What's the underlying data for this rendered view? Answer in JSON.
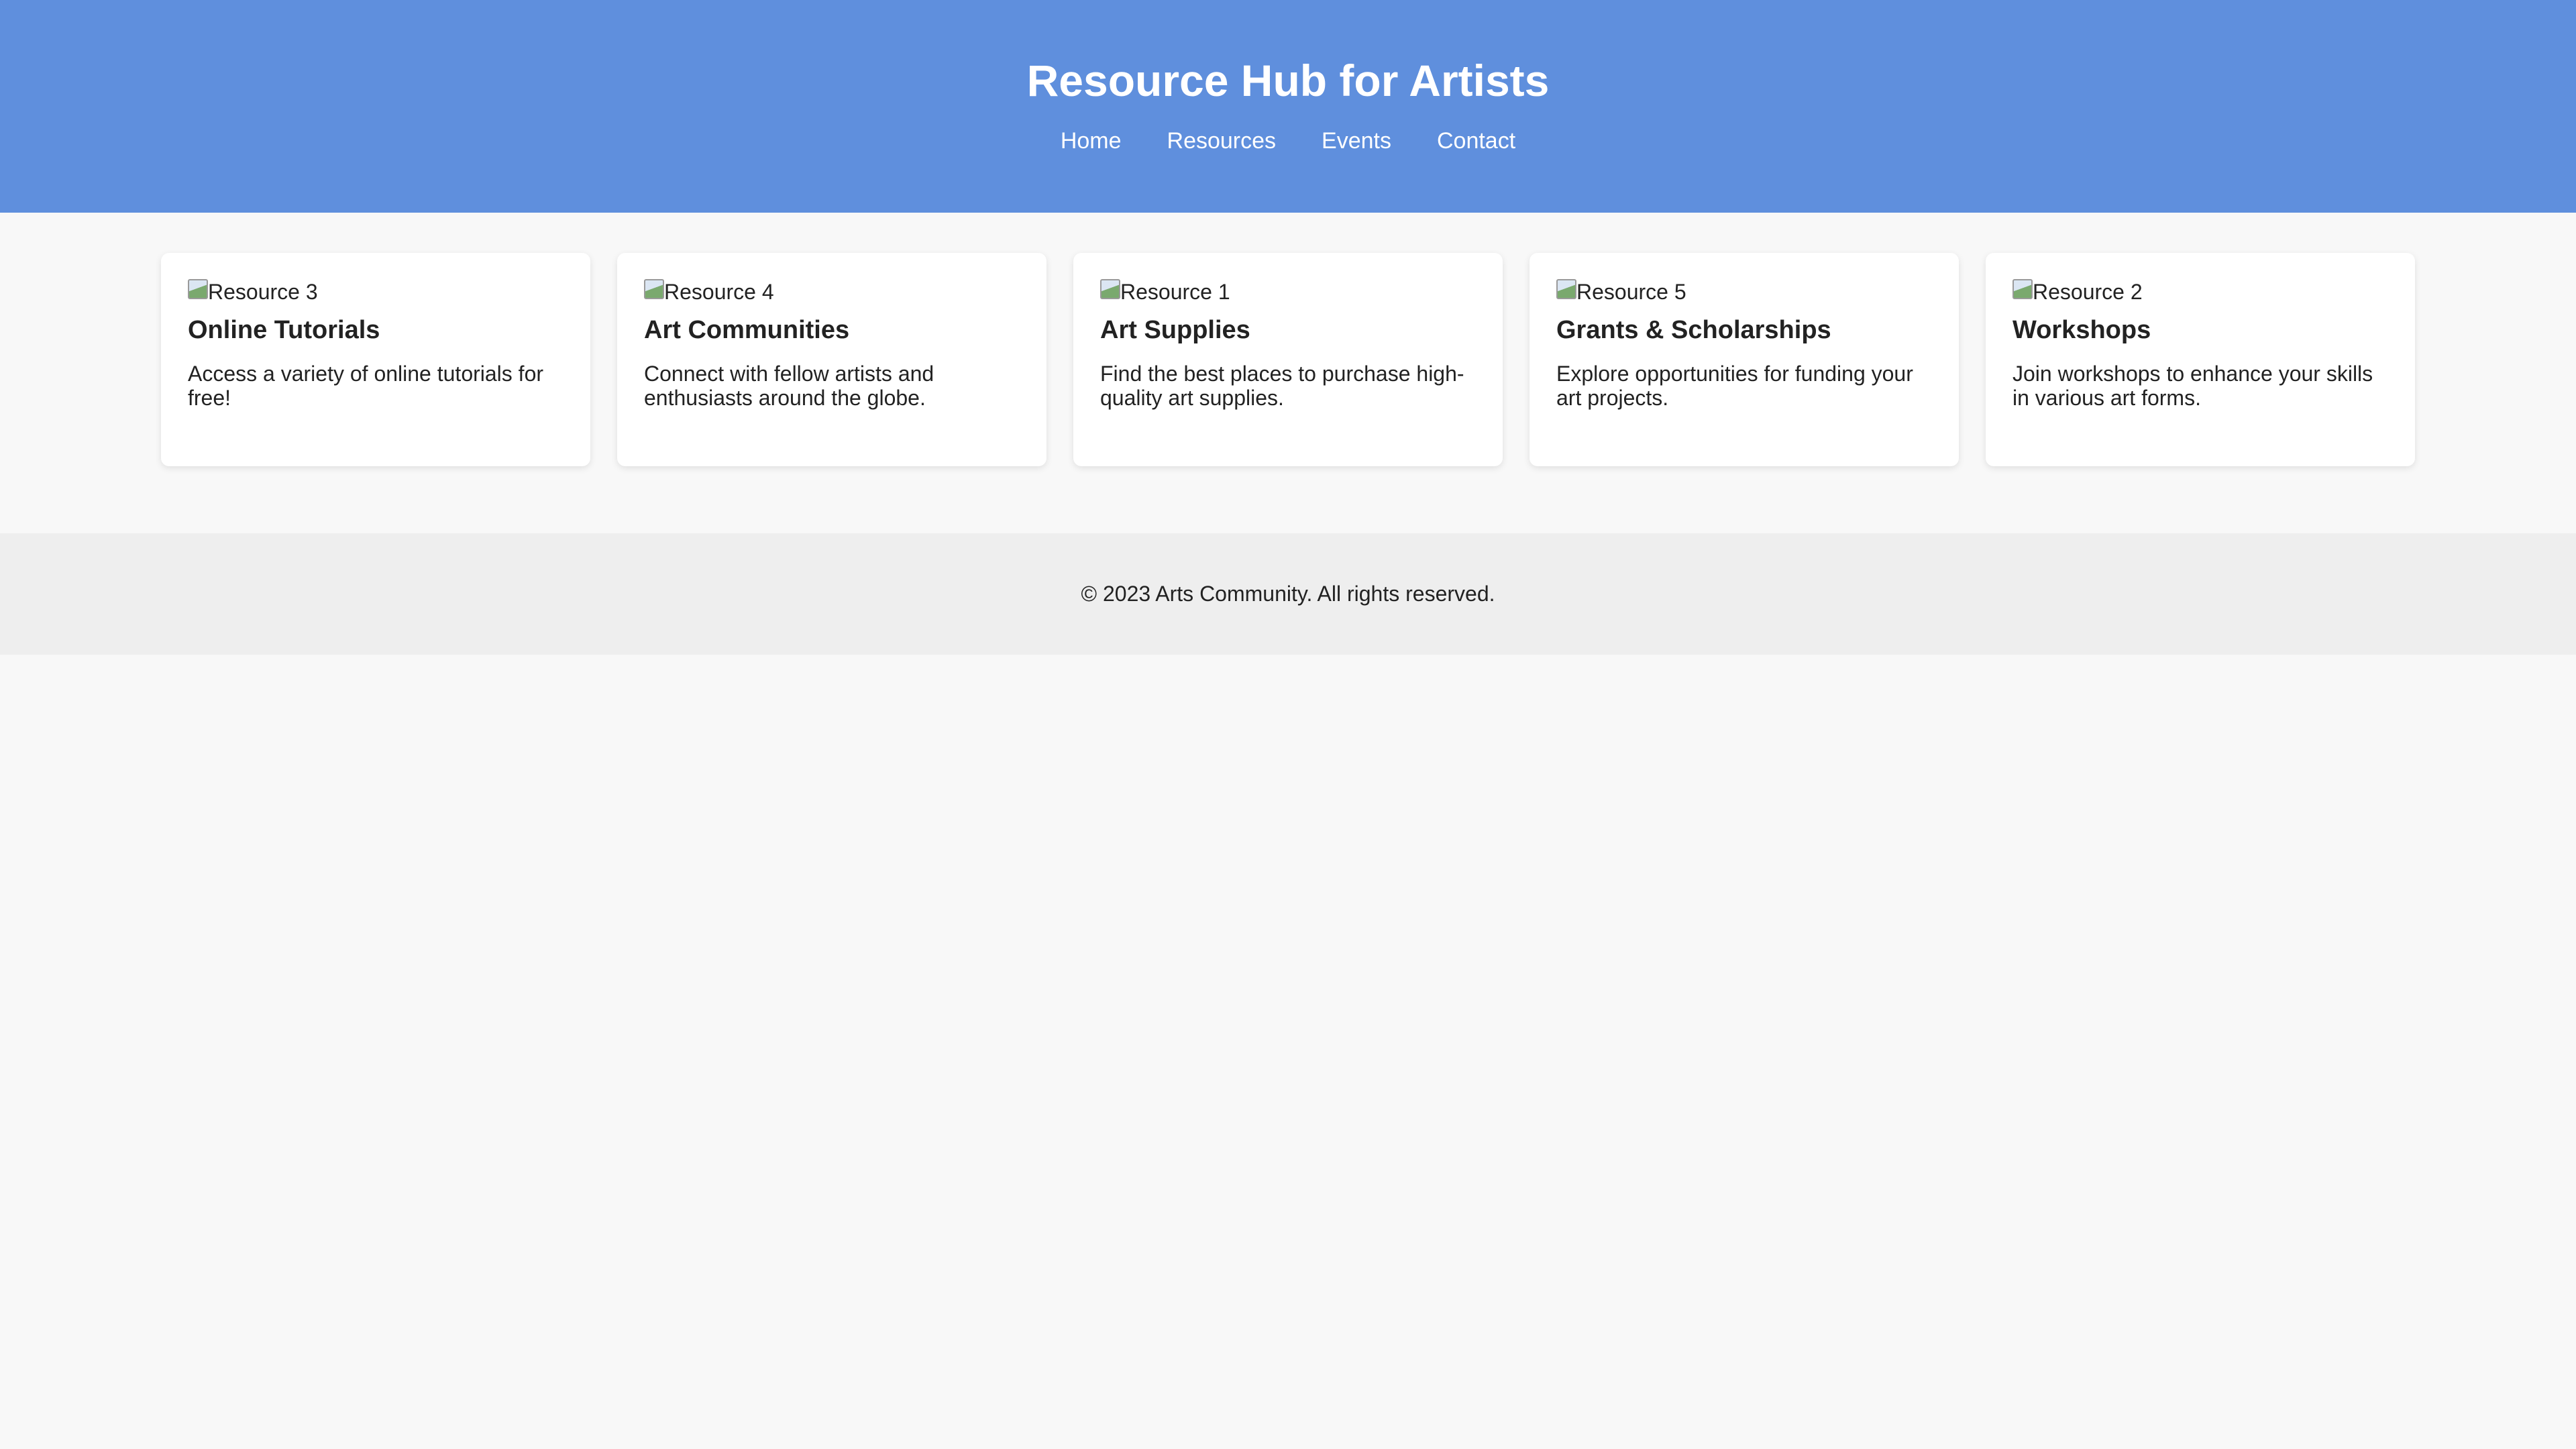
{
  "header": {
    "title": "Resource Hub for Artists",
    "nav": [
      {
        "label": "Home"
      },
      {
        "label": "Resources"
      },
      {
        "label": "Events"
      },
      {
        "label": "Contact"
      }
    ]
  },
  "cards": [
    {
      "image_alt": "Resource 3",
      "title": "Online Tutorials",
      "description": "Access a variety of online tutorials for free!"
    },
    {
      "image_alt": "Resource 4",
      "title": "Art Communities",
      "description": "Connect with fellow artists and enthusiasts around the globe."
    },
    {
      "image_alt": "Resource 1",
      "title": "Art Supplies",
      "description": "Find the best places to purchase high-quality art supplies."
    },
    {
      "image_alt": "Resource 5",
      "title": "Grants & Scholarships",
      "description": "Explore opportunities for funding your art projects."
    },
    {
      "image_alt": "Resource 2",
      "title": "Workshops",
      "description": "Join workshops to enhance your skills in various art forms."
    }
  ],
  "footer": {
    "text": "© 2023 Arts Community. All rights reserved."
  },
  "colors": {
    "header_bg": "#5f8fdd",
    "page_bg": "#f8f8f8",
    "footer_bg": "#eeeeee",
    "card_bg": "#ffffff"
  },
  "icons": {
    "card_image": "broken-image-icon"
  }
}
